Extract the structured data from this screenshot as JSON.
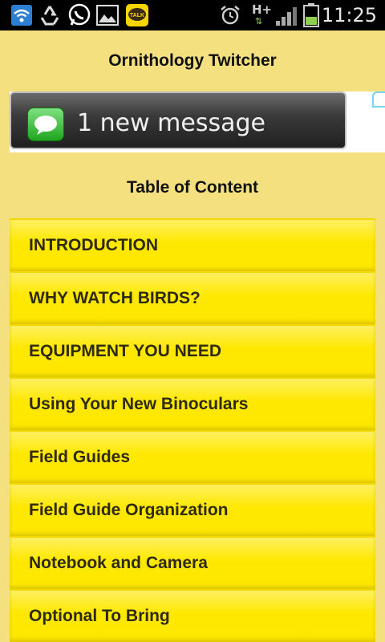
{
  "status_bar": {
    "time": "11:25",
    "network_label": "H+",
    "icons": [
      "wifi-icon",
      "recycle-icon",
      "whatsapp-icon",
      "image-icon",
      "kakaotalk-icon",
      "alarm-icon",
      "signal-icon",
      "battery-icon"
    ],
    "kakao_label": "TALK"
  },
  "app": {
    "title": "Ornithology Twitcher"
  },
  "ad": {
    "message": "1 new message"
  },
  "toc": {
    "heading": "Table of Content",
    "items": [
      {
        "label": "INTRODUCTION"
      },
      {
        "label": "WHY WATCH BIRDS?"
      },
      {
        "label": "EQUIPMENT YOU NEED"
      },
      {
        "label": "Using Your New Binoculars"
      },
      {
        "label": "Field Guides"
      },
      {
        "label": "Field Guide Organization"
      },
      {
        "label": "Notebook and Camera"
      },
      {
        "label": "Optional To Bring"
      }
    ]
  },
  "colors": {
    "background": "#f4e07e",
    "menu_item": "#ffe800",
    "status_bar": "#000000"
  }
}
